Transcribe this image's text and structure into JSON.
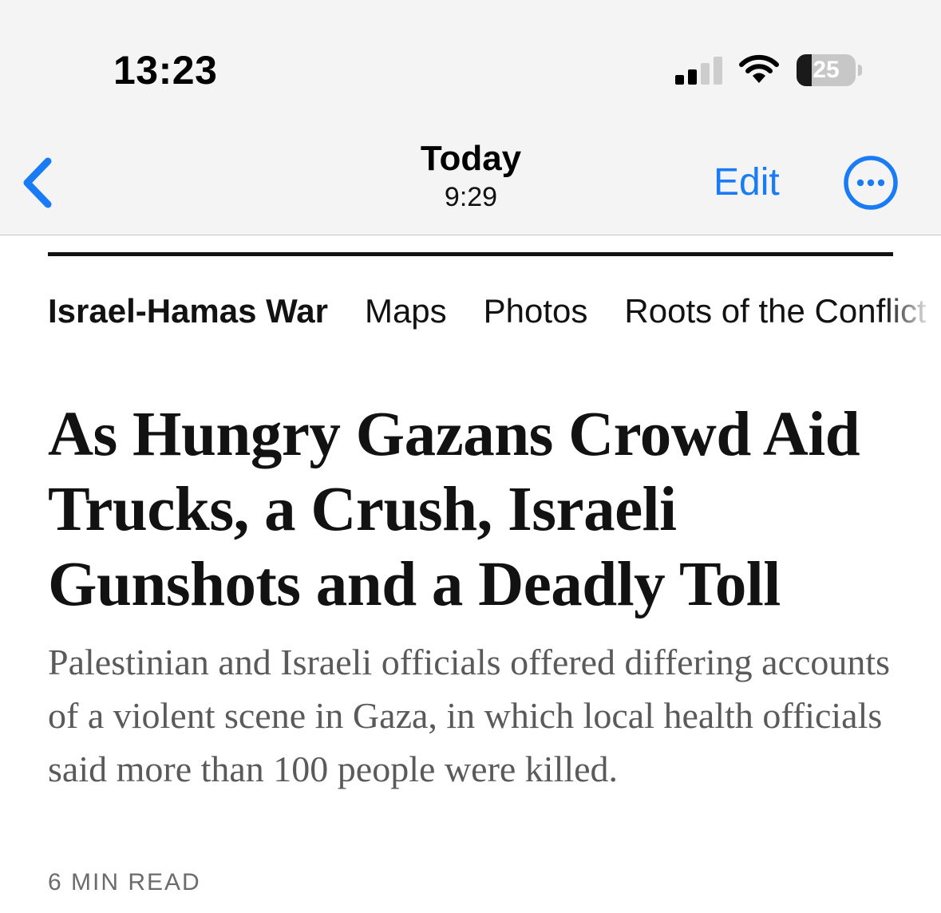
{
  "status_bar": {
    "time": "13:23",
    "battery_level": "25",
    "battery_fraction": 0.25,
    "signal_bars_active": 2,
    "signal_bars_total": 4,
    "signal_icon": "cellular-signal-icon",
    "wifi_icon": "wifi-icon"
  },
  "nav_bar": {
    "back_icon": "chevron-left-icon",
    "title": "Today",
    "subtitle": "9:29",
    "edit_label": "Edit",
    "more_icon": "ellipsis-circle-icon",
    "accent_color": "#1a7cf5"
  },
  "section_nav": {
    "items": [
      {
        "label": "Israel-Hamas War",
        "active": true
      },
      {
        "label": "Maps",
        "active": false
      },
      {
        "label": "Photos",
        "active": false
      },
      {
        "label": "Roots of the Conflict",
        "active": false
      }
    ]
  },
  "article": {
    "headline": "As Hungry Gazans Crowd Aid Trucks, a Crush, Israeli Gunshots and a Deadly Toll",
    "summary": "Palestinian and Israeli officials offered differing accounts of a violent scene in Gaza, in which local health officials said more than 100 people were killed.",
    "read_time": "6 MIN READ"
  }
}
